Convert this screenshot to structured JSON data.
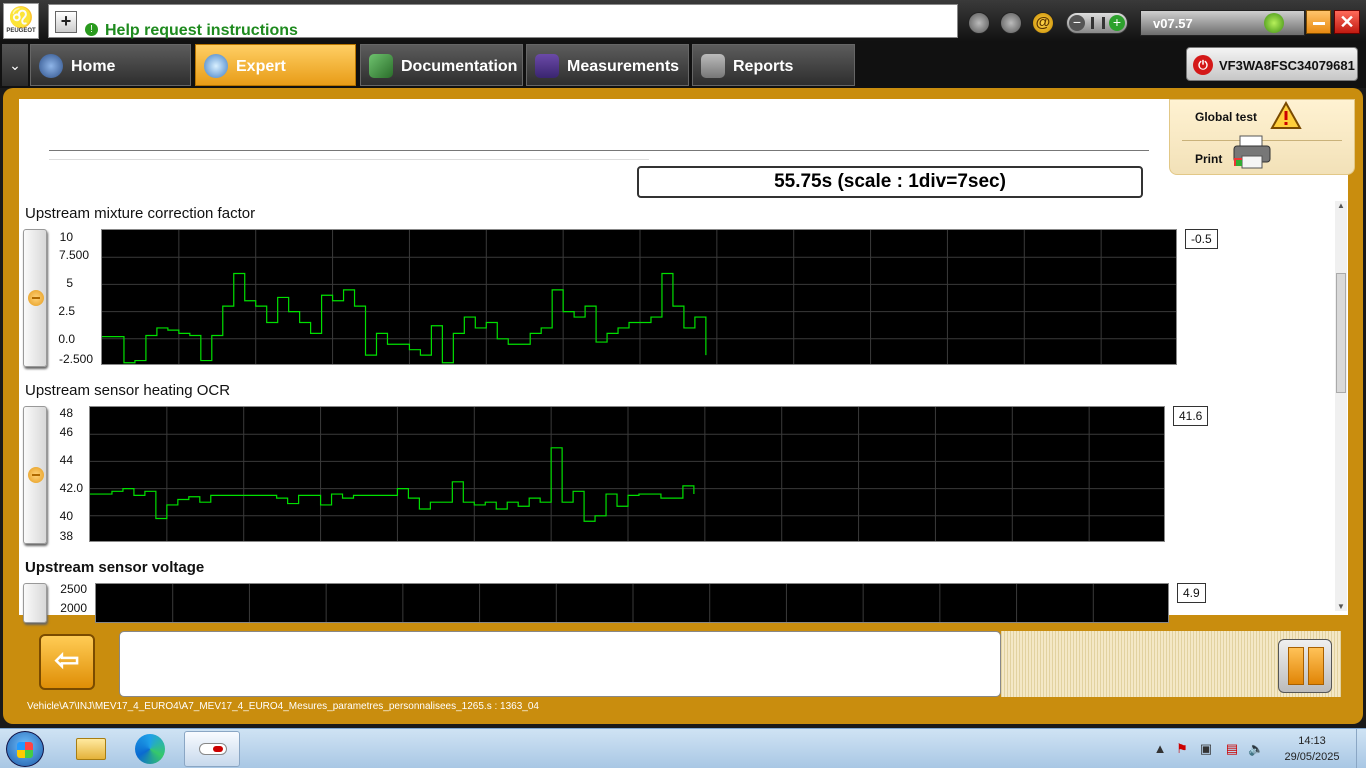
{
  "app": {
    "logo_brand": "PEUGEOT",
    "help_text": "Help request instructions",
    "version": "v07.57",
    "vin": "VF3WA8FSC34079681"
  },
  "nav": {
    "tabs": [
      {
        "label": "Home",
        "active": false
      },
      {
        "label": "Expert",
        "active": true
      },
      {
        "label": "Documentation",
        "active": false
      },
      {
        "label": "Measurements",
        "active": false
      },
      {
        "label": "Reports",
        "active": false
      }
    ]
  },
  "side_panel": {
    "global_test": "Global test",
    "print": "Print"
  },
  "time_display": "55.75s (scale : 1div=7sec)",
  "plots": [
    {
      "title": "Upstream mixture correction factor",
      "title_bold": false,
      "ticks": [
        "10",
        "7.500",
        "5",
        "2.5",
        "0.0",
        "-2.500"
      ],
      "current_value": "-0.5",
      "ylim": [
        -2.5,
        10
      ]
    },
    {
      "title": "Upstream sensor heating OCR",
      "title_bold": false,
      "ticks": [
        "48",
        "46",
        "44",
        "42.0",
        "40",
        "38"
      ],
      "current_value": "41.6",
      "ylim": [
        38,
        48
      ]
    },
    {
      "title": "Upstream sensor voltage",
      "title_bold": true,
      "ticks": [
        "2500",
        "2000"
      ],
      "current_value": "4.9"
    }
  ],
  "chart_data": [
    {
      "type": "line",
      "title": "Upstream mixture correction factor",
      "ylim": [
        -2.5,
        10
      ],
      "x_divisions": 14,
      "x_unit": "s",
      "seconds_per_division": 7,
      "x": [
        0,
        1,
        2,
        3,
        4,
        5,
        6,
        7,
        8,
        9,
        10,
        11,
        12,
        13,
        14,
        15,
        16,
        17,
        18,
        19,
        20,
        21,
        22,
        23,
        24,
        25,
        26,
        27,
        28,
        29,
        30,
        31,
        32,
        33,
        34,
        35,
        36,
        37,
        38,
        39,
        40,
        41,
        42,
        43,
        44,
        45,
        46,
        47,
        48,
        49,
        50,
        51,
        52,
        53,
        54,
        55
      ],
      "series": [
        {
          "color": "#00e000",
          "values": [
            0.2,
            0.2,
            -2.2,
            -2.0,
            0.3,
            1.0,
            0.8,
            0.5,
            0.3,
            -2.0,
            0.3,
            3.0,
            6.0,
            3.5,
            3.0,
            1.5,
            3.8,
            2.5,
            1.5,
            0.5,
            4.0,
            3.5,
            4.5,
            3.0,
            -1.5,
            0.5,
            -0.5,
            -0.5,
            -1.0,
            -1.5,
            1.2,
            -2.2,
            0.5,
            2.0,
            1.0,
            1.5,
            0.0,
            -0.5,
            -0.5,
            0.5,
            1.0,
            4.5,
            2.5,
            2.0,
            3.0,
            -0.3,
            0.5,
            1.0,
            1.5,
            1.5,
            2.0,
            6.0,
            3.0,
            1.0,
            2.0,
            -1.5
          ]
        }
      ]
    },
    {
      "type": "line",
      "title": "Upstream sensor heating OCR",
      "ylim": [
        38,
        48
      ],
      "x_divisions": 14,
      "x_unit": "s",
      "seconds_per_division": 7,
      "x": [
        0,
        1,
        2,
        3,
        4,
        5,
        6,
        7,
        8,
        9,
        10,
        11,
        12,
        13,
        14,
        15,
        16,
        17,
        18,
        19,
        20,
        21,
        22,
        23,
        24,
        25,
        26,
        27,
        28,
        29,
        30,
        31,
        32,
        33,
        34,
        35,
        36,
        37,
        38,
        39,
        40,
        41,
        42,
        43,
        44,
        45,
        46,
        47,
        48,
        49,
        50,
        51,
        52,
        53,
        54,
        55
      ],
      "series": [
        {
          "color": "#00e000",
          "values": [
            41.6,
            41.6,
            41.8,
            42.0,
            41.5,
            41.8,
            39.8,
            40.8,
            41.2,
            41.4,
            41.0,
            41.5,
            41.5,
            41.5,
            41.5,
            41.5,
            41.5,
            41.3,
            40.9,
            41.5,
            41.5,
            40.8,
            41.6,
            41.3,
            41.5,
            41.5,
            41.5,
            41.5,
            42.0,
            41.3,
            40.5,
            41.0,
            41.0,
            42.5,
            41.0,
            40.8,
            41.0,
            40.5,
            41.0,
            40.7,
            41.3,
            41.0,
            45.0,
            41.0,
            41.8,
            39.6,
            40.0,
            41.6,
            40.7,
            41.5,
            41.6,
            41.6,
            41.3,
            41.3,
            42.2,
            41.6
          ]
        }
      ]
    }
  ],
  "status_path": "Vehicle\\A7\\INJ\\MEV17_4_EURO4\\A7_MEV17_4_EURO4_Mesures_parametres_personnalisees_1265.s : 1363_04",
  "taskbar": {
    "time": "14:13",
    "date": "29/05/2025"
  },
  "colors": {
    "frame": "#c98d0e",
    "active_tab": "#f0a823",
    "trace": "#00e000"
  }
}
